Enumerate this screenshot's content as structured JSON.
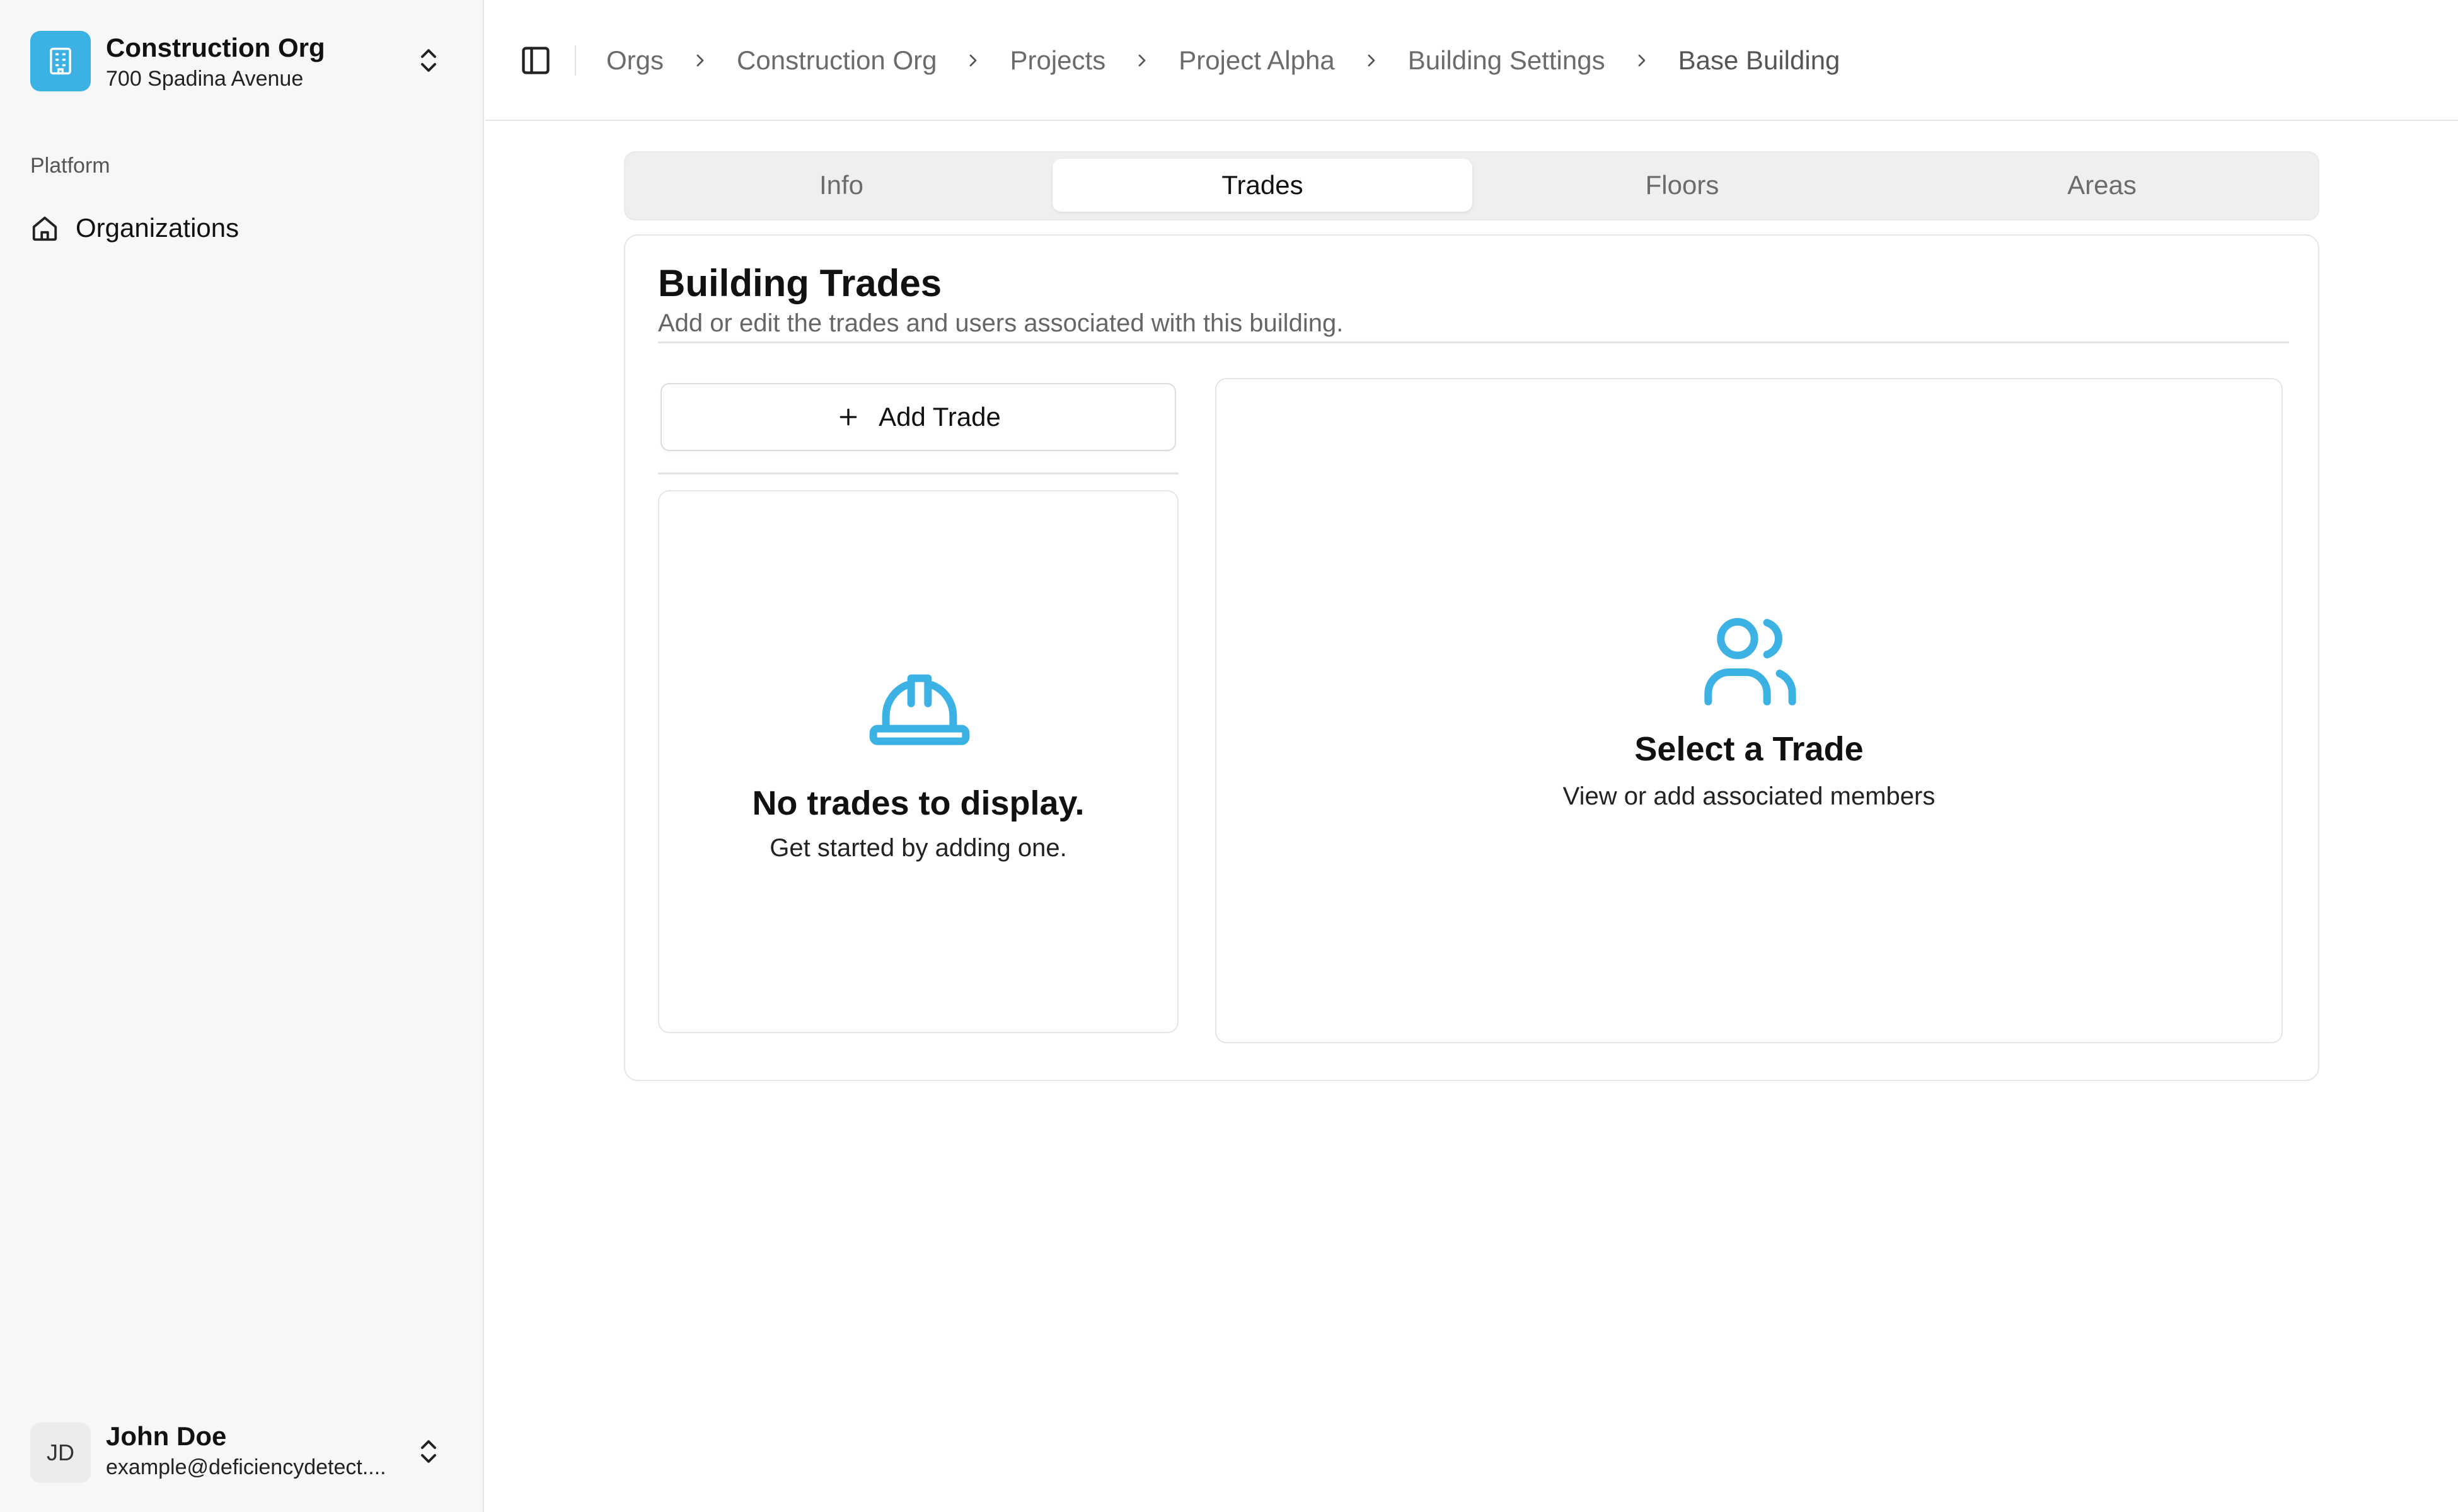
{
  "sidebar": {
    "org": {
      "name": "Construction Org",
      "address": "700 Spadina Avenue"
    },
    "section_label": "Platform",
    "nav": [
      {
        "label": "Organizations",
        "icon": "home-icon"
      }
    ],
    "user": {
      "initials": "JD",
      "name": "John Doe",
      "email": "example@deficiencydetect...."
    }
  },
  "header": {
    "breadcrumbs": [
      "Orgs",
      "Construction Org",
      "Projects",
      "Project Alpha",
      "Building Settings",
      "Base Building"
    ]
  },
  "tabs": [
    {
      "label": "Info",
      "active": false
    },
    {
      "label": "Trades",
      "active": true
    },
    {
      "label": "Floors",
      "active": false
    },
    {
      "label": "Areas",
      "active": false
    }
  ],
  "main": {
    "title": "Building Trades",
    "subtitle": "Add or edit the trades and users associated with this building.",
    "add_trade_label": "Add Trade",
    "empty_state": {
      "title": "No trades to display.",
      "subtitle": "Get started by adding one."
    },
    "select_state": {
      "title": "Select a Trade",
      "subtitle": "View or add associated members"
    }
  },
  "colors": {
    "accent": "#3bb1e4",
    "sidebar_bg": "#f7f7f7",
    "border": "#e6e6e6",
    "tabs_bg": "#efefef"
  }
}
